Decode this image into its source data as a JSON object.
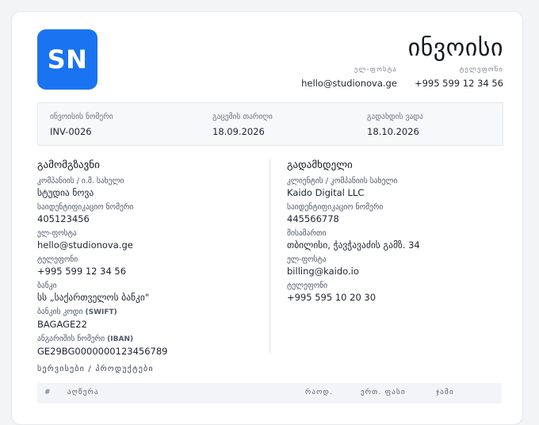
{
  "logo": {
    "text": "SN",
    "color": "#1a73f0"
  },
  "header": {
    "title": "ინვოისი",
    "email_label": "ელ-ფოსტა",
    "email": "hello@studionova.ge",
    "phone_label": "ტელეფონი",
    "phone": "+995 599 12 34 56"
  },
  "meta": {
    "invoice_number_label": "ინვოისის ნომერი",
    "invoice_number": "INV-0026",
    "issue_date_label": "გაცემის თარიღი",
    "issue_date": "18.09.2026",
    "due_date_label": "გადახდის ვადა",
    "due_date": "18.10.2026"
  },
  "sender": {
    "title": "გამომგზავნი",
    "company_label": "კომპანიის / ი.მ. სახელი",
    "company": "სტუდია ნოვა",
    "id_label": "საიდენტიფიკაციო ნომერი",
    "id": "405123456",
    "email_label": "ელ-ფოსტა",
    "email": "hello@studionova.ge",
    "phone_label": "ტელეფონი",
    "phone": "+995 599 12 34 56",
    "bank_label": "ბანკი",
    "bank": "სს „საქართველოს ბანკი\"",
    "swift_label_prefix": "ბანკის კოდი",
    "swift_label_suffix": "(SWIFT)",
    "swift": "BAGAGE22",
    "iban_label_prefix": "ანგარიშის ნომერი",
    "iban_label_suffix": "(IBAN)",
    "iban": "GE29BG0000000123456789"
  },
  "recipient": {
    "title": "გადამხდელი",
    "company_label": "კლიენტის / კომპანიის სახელი",
    "company": "Kaido Digital LLC",
    "id_label": "საიდენტიფიკაციო ნომერი",
    "id": "445566778",
    "address_label": "მისამართი",
    "address": "თბილისი, ჭავჭავაძის გამზ. 34",
    "email_label": "ელ-ფოსტა",
    "email": "billing@kaido.io",
    "phone_label": "ტელეფონი",
    "phone": "+995 595 10 20 30"
  },
  "services": {
    "title": "სერვისები / პროდუქტები",
    "columns": [
      "#",
      "აღწერა",
      "რაოდ.",
      "ერთ. ფასი",
      "ჯამი"
    ]
  }
}
